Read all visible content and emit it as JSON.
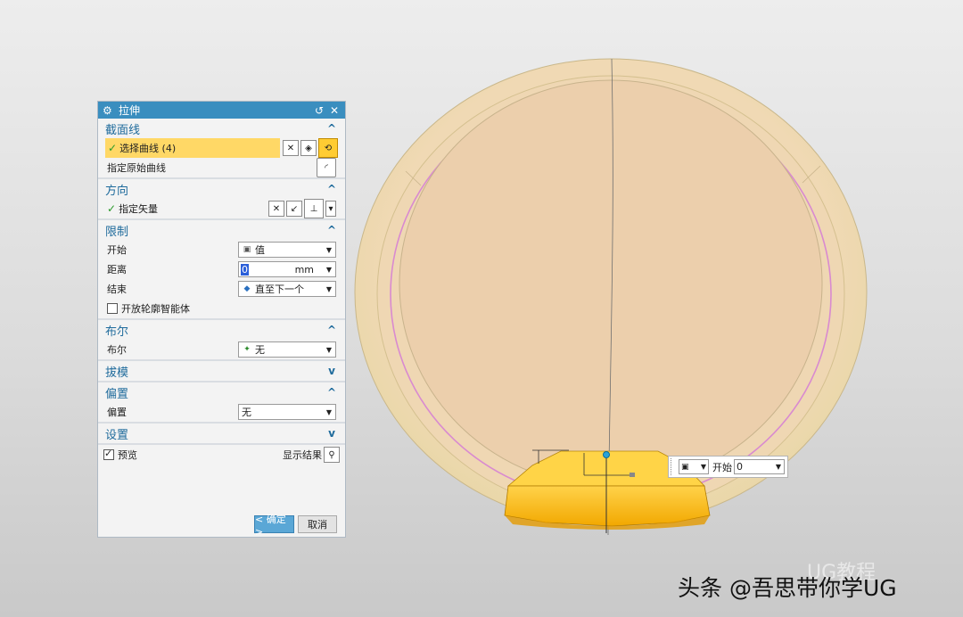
{
  "dialog": {
    "title": "拉伸",
    "section_curve": {
      "title": "截面线",
      "select_curve": "选择曲线 (4)",
      "specify_original": "指定原始曲线"
    },
    "section_direction": {
      "title": "方向",
      "specify_vector": "指定矢量"
    },
    "section_limits": {
      "title": "限制",
      "start_label": "开始",
      "start_value": "值",
      "distance_label": "距离",
      "distance_value": "0",
      "distance_unit": "mm",
      "end_label": "结束",
      "end_value": "直至下一个",
      "open_profile": "开放轮廓智能体"
    },
    "section_boolean": {
      "title": "布尔",
      "label": "布尔",
      "value": "无"
    },
    "section_draft": {
      "title": "拔模"
    },
    "section_offset": {
      "title": "偏置",
      "label": "偏置",
      "value": "无"
    },
    "section_settings": {
      "title": "设置"
    },
    "preview_label": "预览",
    "show_result_label": "显示结果",
    "ok_label": "< 确定 >",
    "cancel_label": "取消"
  },
  "float_input": {
    "label": "开始",
    "value": "0"
  },
  "watermark": {
    "main": "头条 @吾思带你学UG",
    "faded": "UG教程"
  },
  "colors": {
    "title_bar": "#3a8ebf",
    "highlight": "#ffd866",
    "model_body": "#f2dcb6",
    "extrude": "#ffc21a"
  }
}
